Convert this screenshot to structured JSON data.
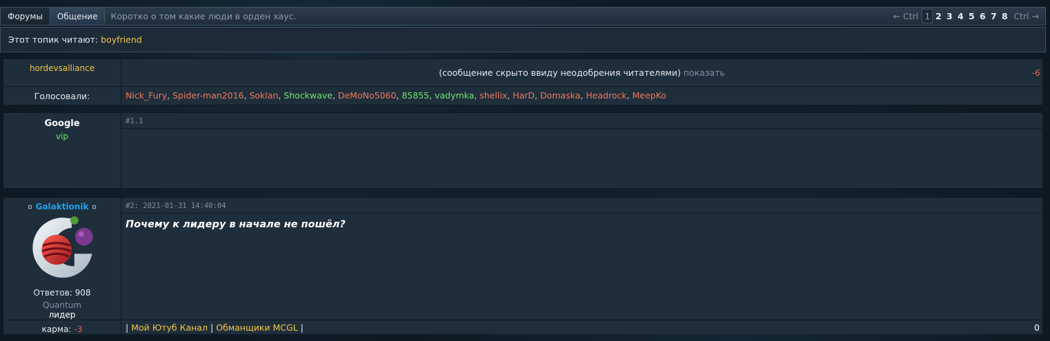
{
  "nav": {
    "crumbs": [
      "Форумы",
      "Общение"
    ],
    "topic_title": "Коротко о том какие люди в орден хаус.",
    "prev_label": "← Ctrl",
    "next_label": "Ctrl →",
    "current_page": "1",
    "pages": [
      "1",
      "2",
      "3",
      "4",
      "5",
      "6",
      "7",
      "8"
    ]
  },
  "readers": {
    "label": "Этот топик читают:",
    "user": "boyfriend"
  },
  "post1": {
    "author": "hordevsalliance",
    "hidden_text": "(сообщение скрыто ввиду неодобрения читателями)",
    "show_label": "показать",
    "score": "-6",
    "voters_label": "Голосовали:",
    "voters": [
      {
        "name": "Nick_Fury",
        "sep": ", "
      },
      {
        "name": "Spider-man2016",
        "sep": ", "
      },
      {
        "name": "Soklan",
        "sep": ", "
      },
      {
        "name": "Shockwave",
        "sep": ", "
      },
      {
        "name": "DeMoNo5060",
        "sep": ", "
      },
      {
        "name": "85855",
        "sep": ", "
      },
      {
        "name": "vadymka",
        "sep": ", "
      },
      {
        "name": "shellix",
        "sep": ", "
      },
      {
        "name": "HarD",
        "sep": ", "
      },
      {
        "name": "Domaska",
        "sep": ", "
      },
      {
        "name": "Headrock",
        "sep": ", "
      },
      {
        "name": "MeepKo",
        "sep": ""
      }
    ],
    "colors": {
      "downvote": "#f0785f",
      "upvote": "#6fe56f"
    }
  },
  "post2": {
    "author": "Google",
    "rank": "vip",
    "number": "#1.1"
  },
  "post3": {
    "author": "Galaktionik",
    "number_date": "#2: 2021-01-31 14:40:04",
    "replies": "Ответов: 908",
    "rank": "Quantum",
    "role": "лидер",
    "body": "Почему к лидеру в начале не пошёл?",
    "karma_label": "карма:",
    "karma_value": "-3",
    "sig_bar": "|",
    "sig_links": [
      "Мой Ютуб Канал",
      "Обманщики MCGL"
    ],
    "score": "0"
  }
}
